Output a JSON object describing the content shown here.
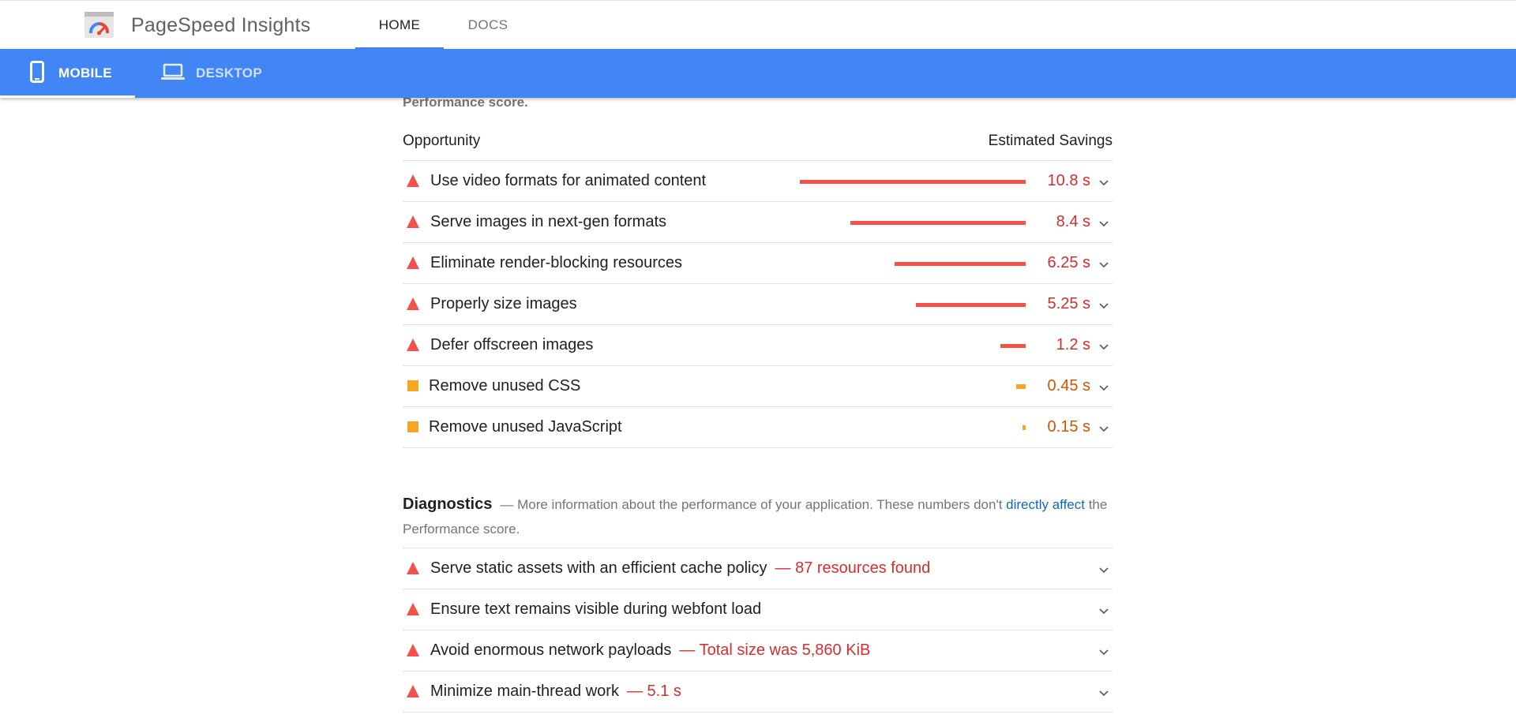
{
  "header": {
    "app_title": "PageSpeed Insights",
    "logo_icon": "pagespeed-gauge-icon",
    "tabs": [
      {
        "label": "HOME",
        "active": true
      },
      {
        "label": "DOCS",
        "active": false
      }
    ]
  },
  "device_bar": {
    "color": "#4285f4",
    "tabs": [
      {
        "label": "MOBILE",
        "icon": "smartphone-icon",
        "active": true
      },
      {
        "label": "DESKTOP",
        "icon": "laptop-icon",
        "active": false
      }
    ]
  },
  "previous_section_tail": "Performance score.",
  "opportunities": {
    "header_left": "Opportunity",
    "header_right": "Estimated Savings",
    "max_saving_s": 10.8,
    "items": [
      {
        "title": "Use video formats for animated content",
        "saving": "10.8 s",
        "saving_s": 10.8,
        "severity": "fail"
      },
      {
        "title": "Serve images in next-gen formats",
        "saving": "8.4 s",
        "saving_s": 8.4,
        "severity": "fail"
      },
      {
        "title": "Eliminate render-blocking resources",
        "saving": "6.25 s",
        "saving_s": 6.25,
        "severity": "fail"
      },
      {
        "title": "Properly size images",
        "saving": "5.25 s",
        "saving_s": 5.25,
        "severity": "fail"
      },
      {
        "title": "Defer offscreen images",
        "saving": "1.2 s",
        "saving_s": 1.2,
        "severity": "fail"
      },
      {
        "title": "Remove unused CSS",
        "saving": "0.45 s",
        "saving_s": 0.45,
        "severity": "average"
      },
      {
        "title": "Remove unused JavaScript",
        "saving": "0.15 s",
        "saving_s": 0.15,
        "severity": "average"
      }
    ]
  },
  "diagnostics": {
    "title": "Diagnostics",
    "description_before": "— More information about the performance of your application. These numbers don't ",
    "link_text": "directly affect",
    "description_after": " the Performance score.",
    "items": [
      {
        "title": "Serve static assets with an efficient cache policy",
        "detail": "— 87 resources found"
      },
      {
        "title": "Ensure text remains visible during webfont load",
        "detail": ""
      },
      {
        "title": "Avoid enormous network payloads",
        "detail": "— Total size was 5,860 KiB"
      },
      {
        "title": "Minimize main-thread work",
        "detail": "— 5.1 s"
      }
    ]
  },
  "colors": {
    "fail": "#f4514a",
    "fail_text": "#d32f2f",
    "average": "#f5a623",
    "average_text": "#d35400",
    "link": "#1565c0"
  }
}
